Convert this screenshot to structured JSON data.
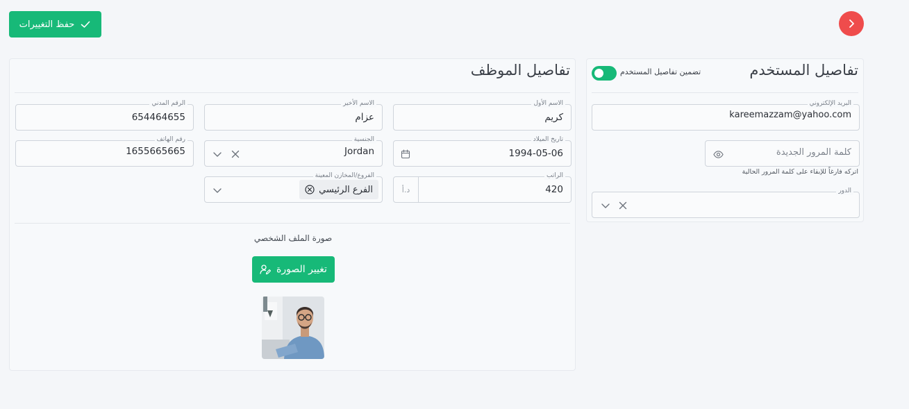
{
  "toolbar": {
    "save_label": "حفظ التغييرات"
  },
  "user_card": {
    "title": "تفاصيل المستخدم",
    "include_toggle_label": "تضمين تفاصيل المستخدم",
    "include_toggle_on": true,
    "email": {
      "label": "البريد الإلكتروني",
      "value": "kareemazzam@yahoo.com"
    },
    "new_password": {
      "placeholder": "كلمة المرور الجديدة",
      "hint": "اتركه فارغاً للإبقاء على كلمة المرور الحالية"
    },
    "role": {
      "label": "الدور",
      "value": ""
    }
  },
  "employee_card": {
    "title": "تفاصيل الموظف",
    "first_name": {
      "label": "الاسم الأول",
      "value": "كريم"
    },
    "last_name": {
      "label": "الاسم الأخير",
      "value": "عزام"
    },
    "civil_id": {
      "label": "الرقم المدني",
      "value": "654464655"
    },
    "birth_date": {
      "label": "تاريخ الميلاد",
      "value": "1994-05-06"
    },
    "nationality": {
      "label": "الجنسية",
      "value": "Jordan"
    },
    "phone": {
      "label": "رقم الهاتف",
      "value": "1655665665"
    },
    "salary": {
      "label": "الراتب",
      "value": "420",
      "currency": "د.أ"
    },
    "branches": {
      "label": "الفروع/المخازن المعينة",
      "selected": [
        "الفرع الرئيسي"
      ]
    },
    "profile_photo": {
      "label": "صورة الملف الشخصي",
      "change_button": "تغيير الصورة"
    }
  },
  "colors": {
    "accent": "#17b978",
    "danger": "#ef4c4c",
    "background": "#f4f6f9"
  },
  "icons": [
    "check-icon",
    "chevron-right-icon",
    "eye-icon",
    "chevron-down-icon",
    "close-icon",
    "calendar-icon",
    "circle-close-icon",
    "edit-user-icon"
  ]
}
